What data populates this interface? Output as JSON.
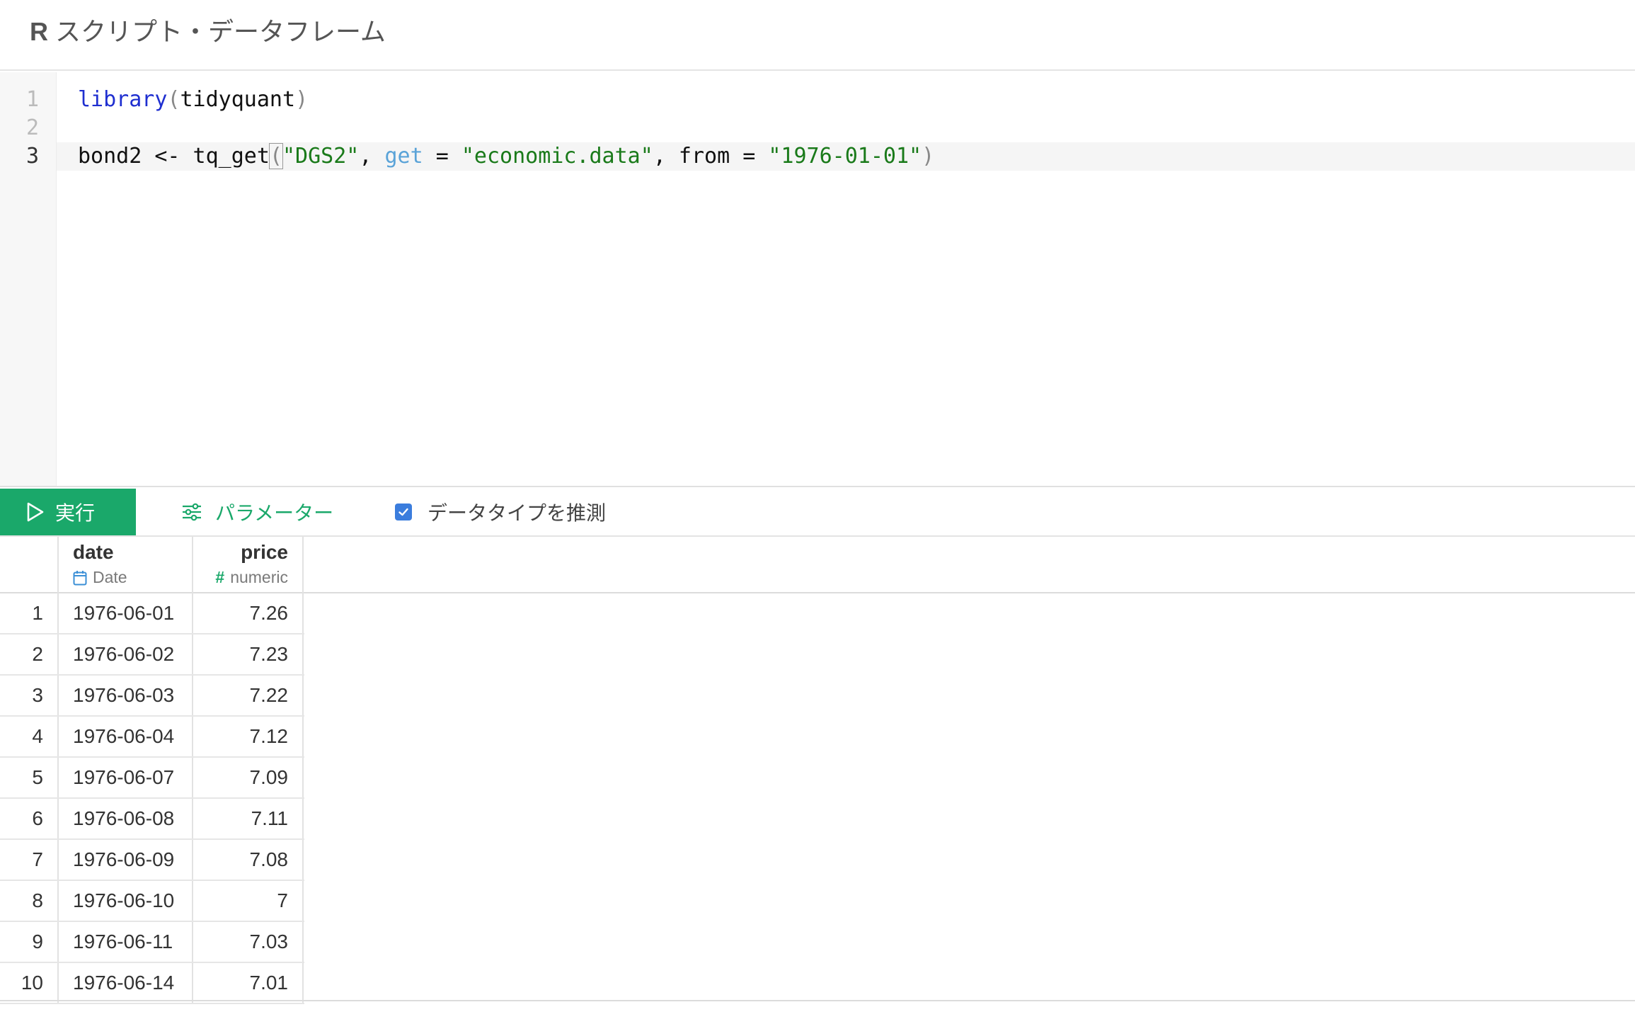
{
  "header": {
    "badge": "R",
    "title": "スクリプト・データフレーム"
  },
  "editor": {
    "line_numbers": [
      "1",
      "2",
      "3"
    ],
    "active_line": 3,
    "lines": [
      {
        "tokens": [
          {
            "text": "library",
            "kind": "func"
          },
          {
            "text": "(",
            "kind": "paren"
          },
          {
            "text": "tidyquant",
            "kind": "plain"
          },
          {
            "text": ")",
            "kind": "paren"
          }
        ]
      },
      {
        "tokens": []
      },
      {
        "tokens": [
          {
            "text": "bond2 <- tq_get",
            "kind": "plain"
          },
          {
            "text": "(",
            "kind": "bracket"
          },
          {
            "text": "\"DGS2\"",
            "kind": "str"
          },
          {
            "text": ", ",
            "kind": "plain"
          },
          {
            "text": "get",
            "kind": "arg"
          },
          {
            "text": " = ",
            "kind": "plain"
          },
          {
            "text": "\"economic.data\"",
            "kind": "str"
          },
          {
            "text": ", from = ",
            "kind": "plain"
          },
          {
            "text": "\"1976-01-01\"",
            "kind": "str"
          },
          {
            "text": ")",
            "kind": "paren"
          }
        ]
      }
    ]
  },
  "toolbar": {
    "run_label": "実行",
    "run_icon": "play-icon",
    "params_label": "パラメーター",
    "params_icon": "sliders-icon",
    "infer_label": "データタイプを推測",
    "infer_checked": true,
    "accent_color": "#1aa86a",
    "checkbox_color": "#3b7ddd"
  },
  "table": {
    "columns": [
      {
        "name": "date",
        "type": "Date",
        "type_icon": "calendar-icon"
      },
      {
        "name": "price",
        "type": "numeric",
        "type_icon": "hash-icon"
      }
    ],
    "rows": [
      {
        "n": "1",
        "date": "1976-06-01",
        "price": "7.26"
      },
      {
        "n": "2",
        "date": "1976-06-02",
        "price": "7.23"
      },
      {
        "n": "3",
        "date": "1976-06-03",
        "price": "7.22"
      },
      {
        "n": "4",
        "date": "1976-06-04",
        "price": "7.12"
      },
      {
        "n": "5",
        "date": "1976-06-07",
        "price": "7.09"
      },
      {
        "n": "6",
        "date": "1976-06-08",
        "price": "7.11"
      },
      {
        "n": "7",
        "date": "1976-06-09",
        "price": "7.08"
      },
      {
        "n": "8",
        "date": "1976-06-10",
        "price": "7"
      },
      {
        "n": "9",
        "date": "1976-06-11",
        "price": "7.03"
      },
      {
        "n": "10",
        "date": "1976-06-14",
        "price": "7.01"
      }
    ]
  }
}
